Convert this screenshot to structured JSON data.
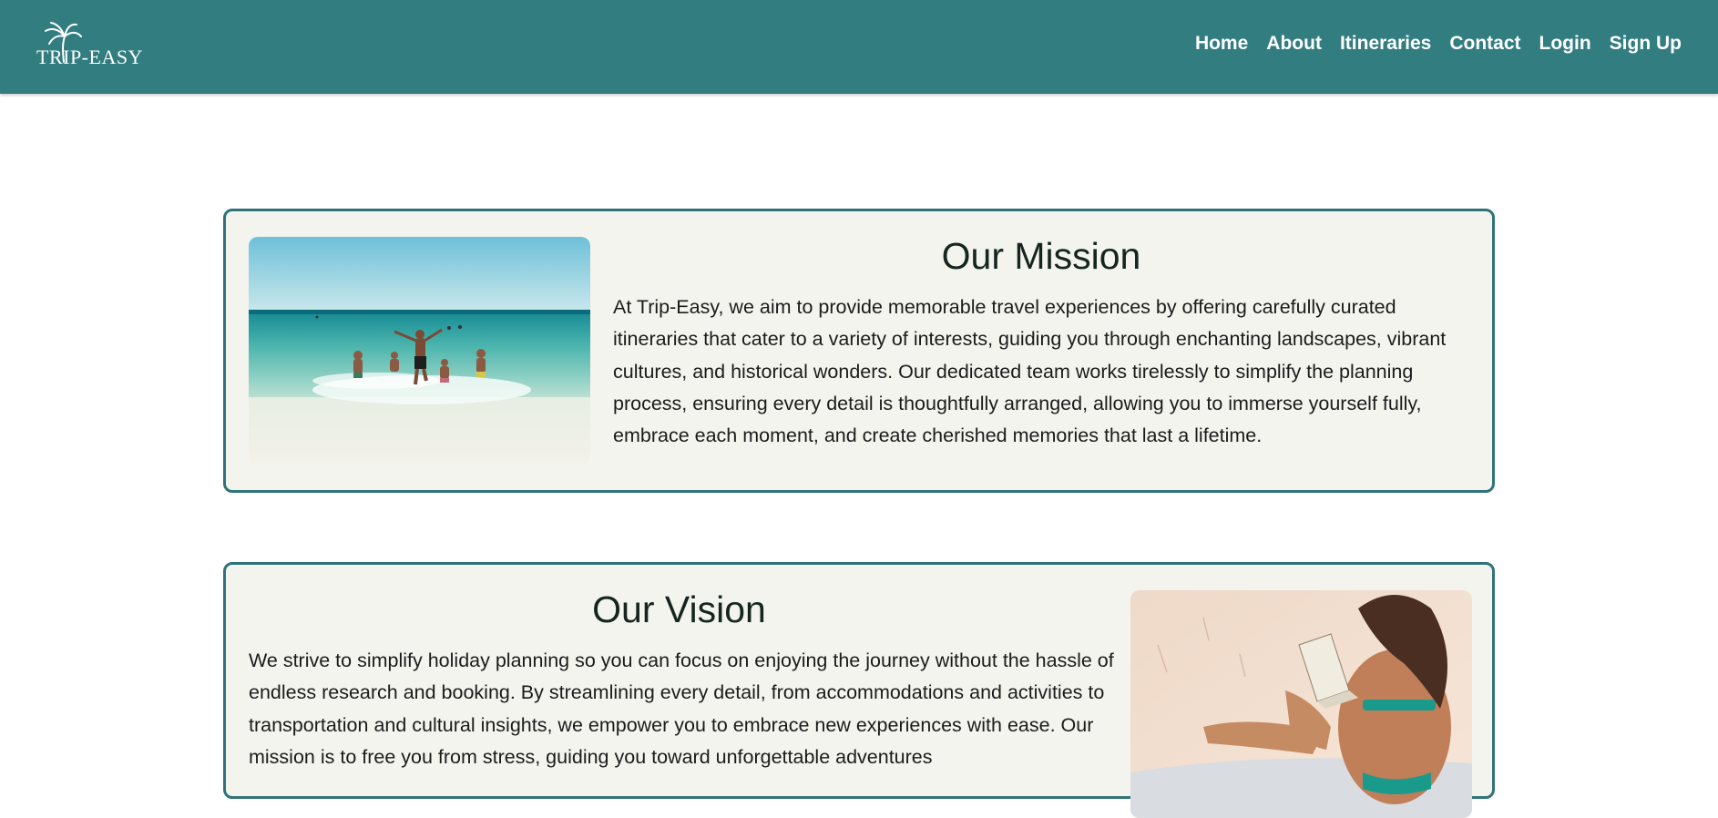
{
  "header": {
    "logo_text": "TRIP-EASY",
    "logo_icon": "palm-tree-icon",
    "nav": [
      {
        "label": "Home"
      },
      {
        "label": "About"
      },
      {
        "label": "Itineraries"
      },
      {
        "label": "Contact"
      },
      {
        "label": "Login"
      },
      {
        "label": "Sign Up"
      }
    ]
  },
  "mission": {
    "title": "Our Mission",
    "text": "At Trip-Easy, we aim to provide memorable travel experiences by offering carefully curated itineraries that cater to a variety of interests, guiding you through enchanting landscapes, vibrant cultures, and historical wonders. Our dedicated team works tirelessly to simplify the planning process, ensuring every detail is thoughtfully arranged, allowing you to immerse yourself fully, embrace each moment, and create cherished memories that last a lifetime."
  },
  "vision": {
    "title": "Our Vision",
    "text": "We strive to simplify holiday planning so you can focus on enjoying the journey without the hassle of endless research and booking. By streamlining every detail, from accommodations and activities to transportation and cultural insights, we empower you to embrace new experiences with ease. Our mission is to free you from stress, guiding you toward unforgettable adventures"
  },
  "colors": {
    "header_bg": "#327d80",
    "card_border": "#2f7378",
    "card_bg": "#f4f4ef"
  }
}
